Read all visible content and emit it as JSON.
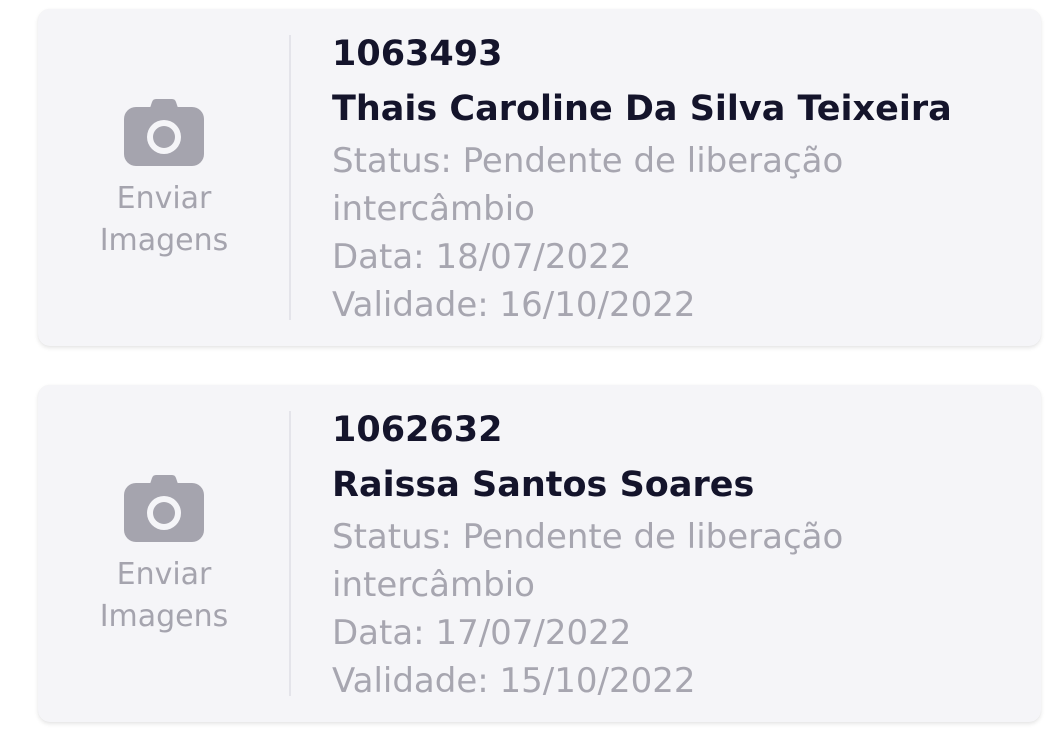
{
  "orders": [
    {
      "upload_label": "Enviar Imagens",
      "id": "1063493",
      "name": "Thais Caroline Da Silva Teixeira",
      "status": "Status: Pendente de liberação intercâmbio",
      "date": "Data: 18/07/2022",
      "validity": "Validade: 16/10/2022"
    },
    {
      "upload_label": "Enviar Imagens",
      "id": "1062632",
      "name": "Raissa Santos Soares",
      "status": "Status: Pendente de liberação intercâmbio",
      "date": "Data: 17/07/2022",
      "validity": "Validade: 15/10/2022"
    }
  ],
  "icons": {
    "upload": "camera-icon"
  },
  "colors": {
    "card_bg": "#f5f5f8",
    "title": "#14142b",
    "muted": "#a7a6b0",
    "icon": "#a5a4ae"
  }
}
